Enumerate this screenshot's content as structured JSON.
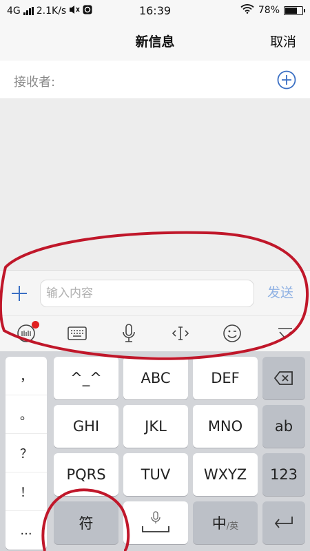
{
  "status_bar": {
    "network": "4G",
    "speed": "2.1K/s",
    "time": "16:39",
    "battery": "78%",
    "battery_level": 0.78
  },
  "header": {
    "title": "新信息",
    "cancel": "取消"
  },
  "recipient": {
    "label": "接收者:"
  },
  "compose": {
    "placeholder": "输入内容",
    "send": "发送"
  },
  "toolbar": {
    "items": [
      "ifly-logo-icon",
      "keyboard-icon",
      "mic-icon",
      "cursor-move-icon",
      "emoji-icon",
      "collapse-icon"
    ]
  },
  "keyboard": {
    "punctuation": [
      "，",
      "。",
      "？",
      "！",
      "..."
    ],
    "row1": [
      "^_^",
      "ABC",
      "DEF"
    ],
    "row2": [
      "GHI",
      "JKL",
      "MNO"
    ],
    "row3": [
      "PQRS",
      "TUV",
      "WXYZ"
    ],
    "fu": "符",
    "zhong": "中",
    "ying": "/英",
    "ab": "ab",
    "num": "123"
  },
  "colors": {
    "accent": "#3a6fc4",
    "send_disabled": "#8fb1e3",
    "annotation": "#c0172a"
  }
}
